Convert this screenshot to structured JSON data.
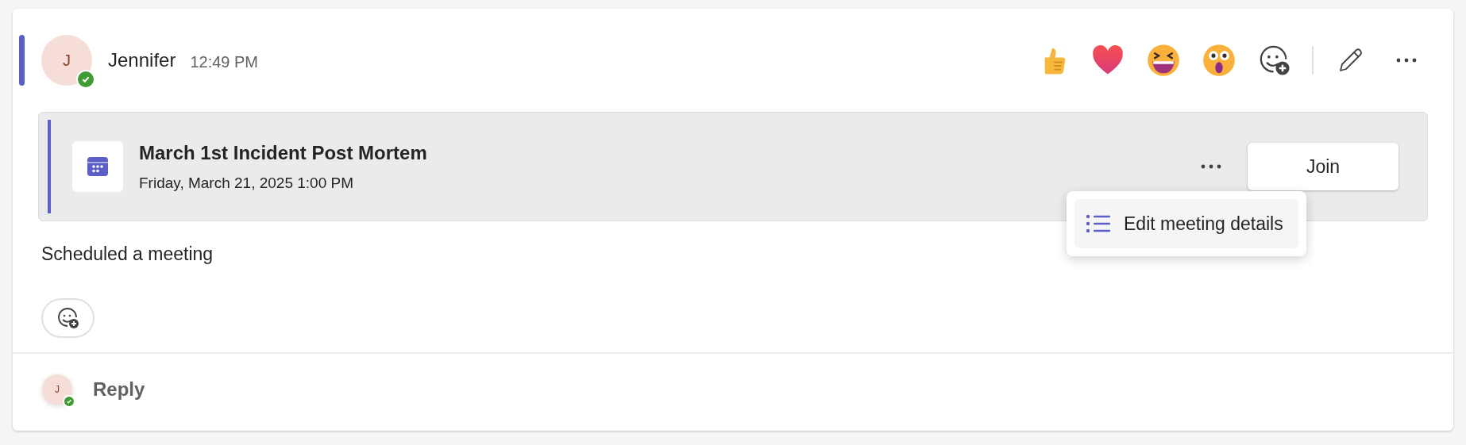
{
  "message": {
    "author": "Jennifer",
    "avatar_initial": "J",
    "online": true,
    "time": "12:49 PM",
    "quick_actions": [
      {
        "kind": "like"
      },
      {
        "kind": "heart"
      },
      {
        "kind": "laugh"
      },
      {
        "kind": "surprised"
      },
      {
        "kind": "add_reaction"
      },
      {
        "kind": "edit"
      },
      {
        "kind": "more"
      }
    ],
    "meeting": {
      "title": "March 1st Incident Post Mortem",
      "datetime": "Friday, March 21, 2025 1:00 PM",
      "join_button": "Join",
      "menu": {
        "items": [
          {
            "label": "Edit meeting details",
            "selected": true
          }
        ]
      }
    },
    "text": "Scheduled a meeting"
  },
  "reply": {
    "avatar_initial": "J",
    "online": true,
    "placeholder": "Reply"
  }
}
